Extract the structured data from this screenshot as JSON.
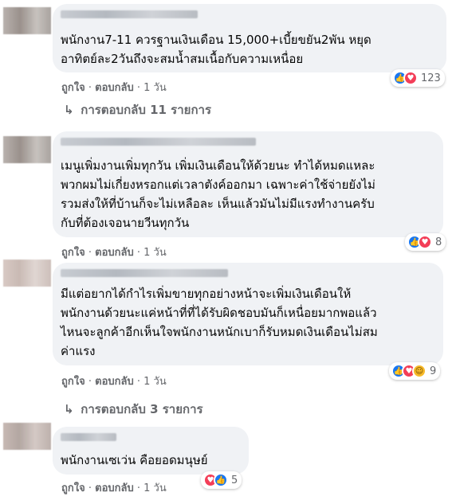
{
  "comments": [
    {
      "lines": [
        "พนักงาน7-11 ควรฐานเงินเดือน 15,000+เบี้ยขยัน2พัน หยุด",
        "อาทิตย์ละ2วันถึงจะสมน้ำสมเนื้อกับความเหนื่อย"
      ],
      "like_label": "ถูกใจ",
      "reply_label": "ตอบกลับ",
      "time": "1 วัน",
      "reaction_count": "123",
      "replies_label": "การตอบกลับ 11 รายการ"
    },
    {
      "lines": [
        "เมนูเพิ่มงานเพิ่มทุกวัน เพิ่มเงินเดือนให้ด้วยนะ ทำได้หมดแหละ",
        "พวกผมไม่เกี่ยงหรอกแต่เวลาตังค์ออกมา เฉพาะค่าใช้จ่ายยังไม่",
        "รวมส่งให้ที่บ้านก็จะไม่เหลือละ เห็นแล้วมันไม่มีแรงทำงานครับ",
        "กับที่ต้องเจอนายวีนทุกวัน"
      ],
      "like_label": "ถูกใจ",
      "reply_label": "ตอบกลับ",
      "time": "1 วัน",
      "reaction_count": "8"
    },
    {
      "lines": [
        "มีแต่อยากได้กำไรเพิ่มขายทุกอย่างหน้าจะเพิ่มเงินเดือนให้",
        "พนักงานด้วยนะแค่หน้าที่ที่ได้รับผิดชอบมันก็เหนื่อยมากพอแล้ว",
        "ไหนจะลูกค้าอีกเห็นใจพนักงานหนักเบาก็รับหมดเงินเดือนไม่สม",
        "ค่าแรง"
      ],
      "like_label": "ถูกใจ",
      "reply_label": "ตอบกลับ",
      "time": "1 วัน",
      "reaction_count": "9",
      "replies_label": "การตอบกลับ 3 รายการ"
    },
    {
      "lines": [
        "พนักงานเซเว่น คือยอดมนุษย์"
      ],
      "like_label": "ถูกใจ",
      "reply_label": "ตอบกลับ",
      "time": "1 วัน",
      "reaction_count": "5"
    }
  ],
  "separator": "·",
  "icons": {
    "like": "thumbs-up-icon",
    "love": "heart-icon",
    "haha": "laugh-icon",
    "reply_arrow": "reply-arrow-icon"
  },
  "colors": {
    "bubble": "#f0f2f5",
    "like": "#1877f2",
    "love": "#f33e58",
    "haha": "#f7b928",
    "meta": "#65676b"
  }
}
